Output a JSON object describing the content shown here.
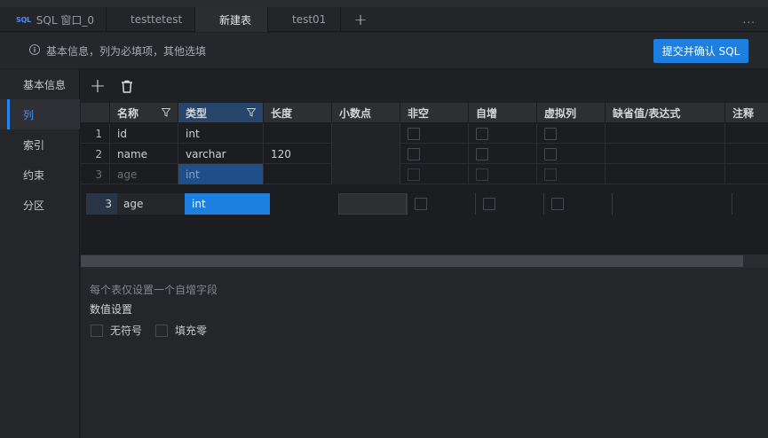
{
  "tabs": [
    {
      "badge": "SQL",
      "label": "SQL 窗口_0"
    },
    {
      "label": "testtetest"
    },
    {
      "label": "新建表"
    },
    {
      "label": "test01"
    }
  ],
  "tab_plus": "+",
  "tab_more": "...",
  "info": {
    "icon_glyph": "i",
    "text": "基本信息，列为必填项，其他选填",
    "submit_label": "提交并确认 SQL"
  },
  "sidebar": {
    "items": [
      {
        "label": "基本信息"
      },
      {
        "label": "列"
      },
      {
        "label": "索引"
      },
      {
        "label": "约束"
      },
      {
        "label": "分区"
      }
    ]
  },
  "toolbar": {
    "add_glyph": "+"
  },
  "grid": {
    "columns": [
      "名称",
      "类型",
      "长度",
      "小数点",
      "非空",
      "自增",
      "虚拟列",
      "缺省值/表达式",
      "注释"
    ],
    "rows": [
      {
        "num": "1",
        "name": "id",
        "type": "int",
        "length": ""
      },
      {
        "num": "2",
        "name": "name",
        "type": "varchar",
        "length": "120"
      },
      {
        "num": "3",
        "name": "age",
        "type": "int",
        "length": ""
      }
    ],
    "drag_row": {
      "num": "3",
      "name": "age",
      "type": "int"
    }
  },
  "bottom": {
    "hint": "每个表仅设置一个自增字段",
    "section_title": "数值设置",
    "options": [
      {
        "label": "无符号"
      },
      {
        "label": "填充零"
      }
    ]
  },
  "colors": {
    "accent": "#1d7fe0",
    "background": "#1f2023",
    "sidebar": "#25262a",
    "selection": "#1f4f86"
  }
}
